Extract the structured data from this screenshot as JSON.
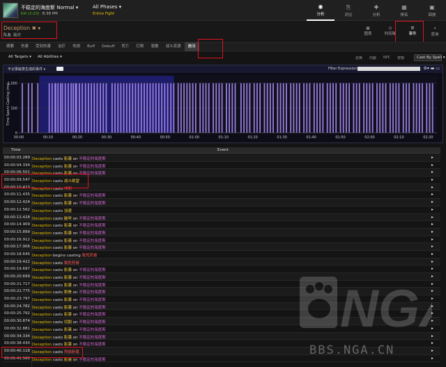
{
  "header": {
    "boss_title": "不稳定的海度斯 Normal",
    "kill_text": "Kill (2:23)",
    "date_text": "8:38 PM",
    "phases_label": "All Phases",
    "phases_sub": "Entire Fight",
    "nav": [
      {
        "label": "分析",
        "icon": "eye-icon",
        "glyph": "◉"
      },
      {
        "label": "对比",
        "icon": "compare-icon",
        "glyph": "⎘"
      },
      {
        "label": "分析",
        "icon": "puzzle-icon",
        "glyph": "✚"
      },
      {
        "label": "排名",
        "icon": "ranking-icon",
        "glyph": "▦"
      },
      {
        "label": "回放",
        "icon": "replay-icon",
        "glyph": "▣"
      }
    ]
  },
  "player": {
    "name": "Deception",
    "name_suffix": "✖ ▾",
    "sub_left": "队友",
    "sub_right": "敌对"
  },
  "views": [
    {
      "label": "图表",
      "icon": "grid-icon",
      "glyph": "▦"
    },
    {
      "label": "时间轴",
      "icon": "clock-icon",
      "glyph": "◷"
    },
    {
      "label": "事件",
      "icon": "list-icon",
      "glyph": "☰"
    },
    {
      "label": "查询",
      "icon": "pin-icon",
      "glyph": "⌖"
    }
  ],
  "tabs": [
    "摘要",
    "伤害",
    "受到伤害",
    "治疗",
    "伤损",
    "Buff",
    "Debuff",
    "死亡",
    "打断",
    "驱散",
    "战斗资源",
    "施法"
  ],
  "filters": {
    "targets": "All Targets ▾",
    "abilities": "All Abilities ▾",
    "roles": [
      "召唤",
      "内嵌",
      "NPC",
      "宠物"
    ],
    "cast_by": "Cast By Spell ▾"
  },
  "chart_panel": {
    "toggle_label": "不记录敌意生成的事件 ▾",
    "filter_expression_label": "Filter Expression:",
    "filter_expression_value": "",
    "icons": "⚙▾ ▬ ▭"
  },
  "chart_data": {
    "type": "bar",
    "ylabel": "Time Spent Casting (ms)",
    "xlabel": "",
    "y_ticks": [
      0,
      500,
      1000
    ],
    "ylim": [
      0,
      1150
    ],
    "x_ticks": [
      "00:00",
      "00:10",
      "00:20",
      "00:30",
      "00:40",
      "00:50",
      "01:00",
      "01:10",
      "01:20",
      "01:30",
      "01:40",
      "01:50",
      "02:00",
      "02:10",
      "02:20"
    ],
    "xlim_seconds": [
      0,
      143
    ],
    "highlight_range_seconds": [
      7,
      53
    ],
    "bar_value": 1000,
    "cast_times_seconds": [
      1.2,
      3.3,
      4.5,
      6.5,
      10.4,
      11.4,
      12.4,
      12.6,
      13.4,
      14.3,
      14.9,
      15.9,
      16.9,
      17.9,
      18.6,
      19.4,
      19.7,
      20.7,
      21.7,
      22.8,
      23.8,
      24.8,
      25.8,
      26.8,
      27.9,
      28.9,
      29.9,
      31.9,
      32.9,
      33.9,
      34.9,
      35.9,
      36.9,
      37.9,
      38.9,
      39.9,
      40.9,
      41.9,
      42.9,
      43.9,
      44.9,
      45.9,
      46.9,
      47.9,
      48.9,
      49.9,
      50.9,
      52.0,
      53.0,
      54.5,
      55.5,
      56.5,
      57.5,
      58.5,
      59.5,
      60.5,
      62.0,
      63.0,
      64.0,
      65.0,
      66.5,
      67.5,
      68.5,
      69.5,
      71.0,
      72.0,
      73.0,
      74.0,
      76.0,
      77.0,
      78.0,
      79.0,
      80.5,
      81.5,
      82.5,
      84.0,
      85.0,
      86.0,
      87.0,
      88.5,
      89.5,
      90.5,
      91.5,
      93.0,
      94.0,
      95.0,
      96.0,
      97.5,
      98.5,
      99.5,
      101.0,
      102.0,
      103.0,
      104.0,
      105.5,
      106.5,
      107.5,
      108.5,
      110.0,
      111.0,
      112.0,
      113.0,
      114.5,
      115.5,
      116.5,
      118.0,
      119.0,
      120.0,
      121.0,
      122.5,
      123.5,
      124.5,
      125.5,
      127.0,
      128.0,
      129.0,
      130.0,
      131.5,
      132.5,
      133.5,
      135.0,
      136.0,
      137.0,
      138.0,
      139.5,
      140.5,
      141.5
    ]
  },
  "table": {
    "col_time": "Time",
    "col_event": "Event",
    "rows": [
      {
        "time": "00:00:03.289",
        "actor": "Deception",
        "verb": "casts",
        "spell": "影袭",
        "on": "on",
        "target": "不稳定的海度斯",
        "style": ""
      },
      {
        "time": "00:00:04.334",
        "actor": "Deception",
        "verb": "casts",
        "spell": "影袭",
        "on": "on",
        "target": "不稳定的海度斯",
        "style": ""
      },
      {
        "time": "00:00:06.501",
        "actor": "Deception",
        "verb": "casts",
        "spell": "影袭",
        "on": "on",
        "target": "不稳定的海度斯",
        "style": ""
      },
      {
        "time": "00:00:09.547",
        "actor": "Deception",
        "verb": "casts",
        "spell": "战斗欲望",
        "on": "",
        "target": "",
        "style": ""
      },
      {
        "time": "00:00:10.423",
        "actor": "Deception",
        "verb": "casts",
        "spell": "冲刺",
        "on": "",
        "target": "",
        "style": "red"
      },
      {
        "time": "00:00:11.435",
        "actor": "Deception",
        "verb": "casts",
        "spell": "影袭",
        "on": "on",
        "target": "不稳定的海度斯",
        "style": ""
      },
      {
        "time": "00:00:12.424",
        "actor": "Deception",
        "verb": "casts",
        "spell": "影袭",
        "on": "on",
        "target": "不稳定的海度斯",
        "style": ""
      },
      {
        "time": "00:00:12.562",
        "actor": "Deception",
        "verb": "casts",
        "spell": "加速",
        "on": "",
        "target": "",
        "style": ""
      },
      {
        "time": "00:00:13.428",
        "actor": "Deception",
        "verb": "casts",
        "spell": "破甲",
        "on": "on",
        "target": "不稳定的海度斯",
        "style": ""
      },
      {
        "time": "00:00:14.909",
        "actor": "Deception",
        "verb": "casts",
        "spell": "影袭",
        "on": "on",
        "target": "不稳定的海度斯",
        "style": ""
      },
      {
        "time": "00:00:15.899",
        "actor": "Deception",
        "verb": "casts",
        "spell": "影袭",
        "on": "on",
        "target": "不稳定的海度斯",
        "style": ""
      },
      {
        "time": "00:00:16.912",
        "actor": "Deception",
        "verb": "casts",
        "spell": "影袭",
        "on": "on",
        "target": "不稳定的海度斯",
        "style": ""
      },
      {
        "time": "00:00:17.906",
        "actor": "Deception",
        "verb": "casts",
        "spell": "影袭",
        "on": "on",
        "target": "不稳定的海度斯",
        "style": ""
      },
      {
        "time": "00:00:18.645",
        "actor": "Deception",
        "verb": "begins casting",
        "spell": "致死药膏",
        "on": "",
        "target": "",
        "style": "red"
      },
      {
        "time": "00:00:19.422",
        "actor": "Deception",
        "verb": "casts",
        "spell": "致死药膏",
        "on": "",
        "target": "",
        "style": "red"
      },
      {
        "time": "00:00:19.697",
        "actor": "Deception",
        "verb": "casts",
        "spell": "影袭",
        "on": "on",
        "target": "不稳定的海度斯",
        "style": ""
      },
      {
        "time": "00:00:20.699",
        "actor": "Deception",
        "verb": "casts",
        "spell": "影袭",
        "on": "on",
        "target": "不稳定的海度斯",
        "style": ""
      },
      {
        "time": "00:00:21.717",
        "actor": "Deception",
        "verb": "casts",
        "spell": "影袭",
        "on": "on",
        "target": "不稳定的海度斯",
        "style": ""
      },
      {
        "time": "00:00:22.775",
        "actor": "Deception",
        "verb": "casts",
        "spell": "刺骨",
        "on": "on",
        "target": "不稳定的海度斯",
        "style": ""
      },
      {
        "time": "00:00:23.797",
        "actor": "Deception",
        "verb": "casts",
        "spell": "影袭",
        "on": "on",
        "target": "不稳定的海度斯",
        "style": ""
      },
      {
        "time": "00:00:24.782",
        "actor": "Deception",
        "verb": "casts",
        "spell": "影袭",
        "on": "on",
        "target": "不稳定的海度斯",
        "style": ""
      },
      {
        "time": "00:00:25.792",
        "actor": "Deception",
        "verb": "casts",
        "spell": "影袭",
        "on": "on",
        "target": "不稳定的海度斯",
        "style": ""
      },
      {
        "time": "00:00:30.874",
        "actor": "Deception",
        "verb": "casts",
        "spell": "切割",
        "on": "on",
        "target": "不稳定的海度斯",
        "style": ""
      },
      {
        "time": "00:00:32.881",
        "actor": "Deception",
        "verb": "casts",
        "spell": "影袭",
        "on": "on",
        "target": "不稳定的海度斯",
        "style": ""
      },
      {
        "time": "00:00:34.334",
        "actor": "Deception",
        "verb": "casts",
        "spell": "影袭",
        "on": "on",
        "target": "不稳定的海度斯",
        "style": ""
      },
      {
        "time": "00:00:38.430",
        "actor": "Deception",
        "verb": "casts",
        "spell": "影袭",
        "on": "on",
        "target": "不稳定的海度斯",
        "style": ""
      },
      {
        "time": "00:00:40.118",
        "actor": "Deception",
        "verb": "casts",
        "spell": "烈焰斩笔",
        "on": "",
        "target": "",
        "style": "red"
      },
      {
        "time": "00:00:41.560",
        "actor": "Deception",
        "verb": "casts",
        "spell": "影袭",
        "on": "on",
        "target": "不稳定的海度斯",
        "style": ""
      }
    ]
  },
  "watermark": {
    "logo": "NGA",
    "text": "BBS.NGA.CN"
  }
}
